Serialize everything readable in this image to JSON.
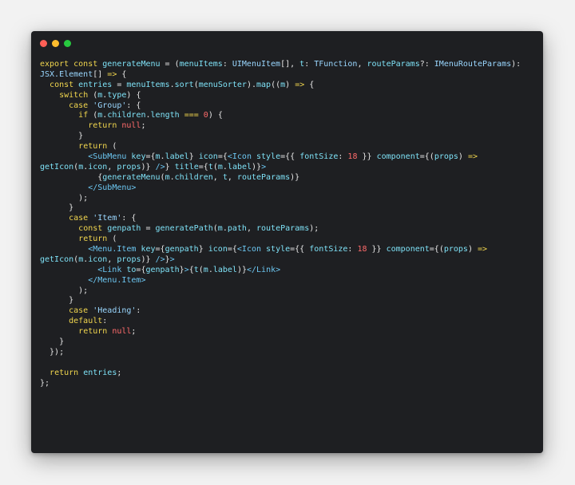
{
  "window": {
    "dots": [
      {
        "name": "close",
        "color": "#ff5f56"
      },
      {
        "name": "minimize",
        "color": "#ffbd2e"
      },
      {
        "name": "maximize",
        "color": "#27c93f"
      }
    ]
  },
  "code": {
    "lines": [
      [
        [
          "kw",
          "export const "
        ],
        [
          "fn",
          "generateMenu"
        ],
        [
          "pun",
          " = ("
        ],
        [
          "att",
          "menuItems"
        ],
        [
          "pun",
          ": "
        ],
        [
          "ty",
          "UIMenuItem"
        ],
        [
          "pun",
          "[], "
        ],
        [
          "att",
          "t"
        ],
        [
          "pun",
          ": "
        ],
        [
          "ty",
          "TFunction"
        ],
        [
          "pun",
          ", "
        ],
        [
          "att",
          "routeParams"
        ],
        [
          "pun",
          "?: "
        ],
        [
          "ty",
          "IMenuRouteParams"
        ],
        [
          "pun",
          "):"
        ]
      ],
      [
        [
          "ty",
          "JSX.Element"
        ],
        [
          "pun",
          "[] "
        ],
        [
          "kw",
          "=>"
        ],
        [
          "pun",
          " {"
        ]
      ],
      [
        [
          "pun",
          "  "
        ],
        [
          "kw",
          "const "
        ],
        [
          "att",
          "entries"
        ],
        [
          "pun",
          " = "
        ],
        [
          "att",
          "menuItems"
        ],
        [
          "pun",
          "."
        ],
        [
          "fn",
          "sort"
        ],
        [
          "pun",
          "("
        ],
        [
          "att",
          "menuSorter"
        ],
        [
          "pun",
          ")."
        ],
        [
          "fn",
          "map"
        ],
        [
          "pun",
          "(("
        ],
        [
          "att",
          "m"
        ],
        [
          "pun",
          ") "
        ],
        [
          "kw",
          "=>"
        ],
        [
          "pun",
          " {"
        ]
      ],
      [
        [
          "pun",
          "    "
        ],
        [
          "kw",
          "switch"
        ],
        [
          "pun",
          " ("
        ],
        [
          "att",
          "m"
        ],
        [
          "pun",
          "."
        ],
        [
          "att",
          "type"
        ],
        [
          "pun",
          ") {"
        ]
      ],
      [
        [
          "pun",
          "      "
        ],
        [
          "kw",
          "case "
        ],
        [
          "str",
          "'Group'"
        ],
        [
          "pun",
          ": {"
        ]
      ],
      [
        [
          "pun",
          "        "
        ],
        [
          "kw",
          "if"
        ],
        [
          "pun",
          " ("
        ],
        [
          "att",
          "m"
        ],
        [
          "pun",
          "."
        ],
        [
          "att",
          "children"
        ],
        [
          "pun",
          "."
        ],
        [
          "att",
          "length"
        ],
        [
          "pun",
          " "
        ],
        [
          "kw",
          "==="
        ],
        [
          "pun",
          " "
        ],
        [
          "num",
          "0"
        ],
        [
          "pun",
          ") {"
        ]
      ],
      [
        [
          "pun",
          "          "
        ],
        [
          "kw",
          "return "
        ],
        [
          "nul",
          "null"
        ],
        [
          "pun",
          ";"
        ]
      ],
      [
        [
          "pun",
          "        }"
        ]
      ],
      [
        [
          "pun",
          "        "
        ],
        [
          "kw",
          "return"
        ],
        [
          "pun",
          " ("
        ]
      ],
      [
        [
          "pun",
          "          "
        ],
        [
          "tag",
          "<SubMenu "
        ],
        [
          "att",
          "key"
        ],
        [
          "pun",
          "={"
        ],
        [
          "att",
          "m"
        ],
        [
          "pun",
          "."
        ],
        [
          "att",
          "label"
        ],
        [
          "pun",
          "} "
        ],
        [
          "att",
          "icon"
        ],
        [
          "pun",
          "={"
        ],
        [
          "tag",
          "<Icon "
        ],
        [
          "att",
          "style"
        ],
        [
          "pun",
          "={{ "
        ],
        [
          "att",
          "fontSize"
        ],
        [
          "pun",
          ": "
        ],
        [
          "num",
          "18"
        ],
        [
          "pun",
          " }} "
        ],
        [
          "att",
          "component"
        ],
        [
          "pun",
          "={("
        ],
        [
          "att",
          "props"
        ],
        [
          "pun",
          ") "
        ],
        [
          "kw",
          "=>"
        ]
      ],
      [
        [
          "fn",
          "getIcon"
        ],
        [
          "pun",
          "("
        ],
        [
          "att",
          "m"
        ],
        [
          "pun",
          "."
        ],
        [
          "att",
          "icon"
        ],
        [
          "pun",
          ", "
        ],
        [
          "att",
          "props"
        ],
        [
          "pun",
          ")} "
        ],
        [
          "tag",
          "/>"
        ],
        [
          "pun",
          "} "
        ],
        [
          "att",
          "title"
        ],
        [
          "pun",
          "={"
        ],
        [
          "fn",
          "t"
        ],
        [
          "pun",
          "("
        ],
        [
          "att",
          "m"
        ],
        [
          "pun",
          "."
        ],
        [
          "att",
          "label"
        ],
        [
          "pun",
          ")}"
        ],
        [
          "tag",
          ">"
        ]
      ],
      [
        [
          "pun",
          "            {"
        ],
        [
          "fn",
          "generateMenu"
        ],
        [
          "pun",
          "("
        ],
        [
          "att",
          "m"
        ],
        [
          "pun",
          "."
        ],
        [
          "att",
          "children"
        ],
        [
          "pun",
          ", "
        ],
        [
          "att",
          "t"
        ],
        [
          "pun",
          ", "
        ],
        [
          "att",
          "routeParams"
        ],
        [
          "pun",
          ")}"
        ]
      ],
      [
        [
          "pun",
          "          "
        ],
        [
          "tag",
          "</SubMenu>"
        ]
      ],
      [
        [
          "pun",
          "        );"
        ]
      ],
      [
        [
          "pun",
          "      }"
        ]
      ],
      [
        [
          "pun",
          "      "
        ],
        [
          "kw",
          "case "
        ],
        [
          "str",
          "'Item'"
        ],
        [
          "pun",
          ": {"
        ]
      ],
      [
        [
          "pun",
          "        "
        ],
        [
          "kw",
          "const "
        ],
        [
          "att",
          "genpath"
        ],
        [
          "pun",
          " = "
        ],
        [
          "fn",
          "generatePath"
        ],
        [
          "pun",
          "("
        ],
        [
          "att",
          "m"
        ],
        [
          "pun",
          "."
        ],
        [
          "att",
          "path"
        ],
        [
          "pun",
          ", "
        ],
        [
          "att",
          "routeParams"
        ],
        [
          "pun",
          ");"
        ]
      ],
      [
        [
          "pun",
          "        "
        ],
        [
          "kw",
          "return"
        ],
        [
          "pun",
          " ("
        ]
      ],
      [
        [
          "pun",
          "          "
        ],
        [
          "tag",
          "<Menu.Item "
        ],
        [
          "att",
          "key"
        ],
        [
          "pun",
          "={"
        ],
        [
          "att",
          "genpath"
        ],
        [
          "pun",
          "} "
        ],
        [
          "att",
          "icon"
        ],
        [
          "pun",
          "={"
        ],
        [
          "tag",
          "<Icon "
        ],
        [
          "att",
          "style"
        ],
        [
          "pun",
          "={{ "
        ],
        [
          "att",
          "fontSize"
        ],
        [
          "pun",
          ": "
        ],
        [
          "num",
          "18"
        ],
        [
          "pun",
          " }} "
        ],
        [
          "att",
          "component"
        ],
        [
          "pun",
          "={("
        ],
        [
          "att",
          "props"
        ],
        [
          "pun",
          ") "
        ],
        [
          "kw",
          "=>"
        ]
      ],
      [
        [
          "fn",
          "getIcon"
        ],
        [
          "pun",
          "("
        ],
        [
          "att",
          "m"
        ],
        [
          "pun",
          "."
        ],
        [
          "att",
          "icon"
        ],
        [
          "pun",
          ", "
        ],
        [
          "att",
          "props"
        ],
        [
          "pun",
          ")} "
        ],
        [
          "tag",
          "/>"
        ],
        [
          "pun",
          "}"
        ],
        [
          "tag",
          ">"
        ]
      ],
      [
        [
          "pun",
          "            "
        ],
        [
          "tag",
          "<Link "
        ],
        [
          "att",
          "to"
        ],
        [
          "pun",
          "={"
        ],
        [
          "att",
          "genpath"
        ],
        [
          "pun",
          "}"
        ],
        [
          "tag",
          ">"
        ],
        [
          "pun",
          "{"
        ],
        [
          "fn",
          "t"
        ],
        [
          "pun",
          "("
        ],
        [
          "att",
          "m"
        ],
        [
          "pun",
          "."
        ],
        [
          "att",
          "label"
        ],
        [
          "pun",
          ")}"
        ],
        [
          "tag",
          "</Link>"
        ]
      ],
      [
        [
          "pun",
          "          "
        ],
        [
          "tag",
          "</Menu.Item>"
        ]
      ],
      [
        [
          "pun",
          "        );"
        ]
      ],
      [
        [
          "pun",
          "      }"
        ]
      ],
      [
        [
          "pun",
          "      "
        ],
        [
          "kw",
          "case "
        ],
        [
          "str",
          "'Heading'"
        ],
        [
          "pun",
          ":"
        ]
      ],
      [
        [
          "pun",
          "      "
        ],
        [
          "kw",
          "default"
        ],
        [
          "pun",
          ":"
        ]
      ],
      [
        [
          "pun",
          "        "
        ],
        [
          "kw",
          "return "
        ],
        [
          "nul",
          "null"
        ],
        [
          "pun",
          ";"
        ]
      ],
      [
        [
          "pun",
          "    }"
        ]
      ],
      [
        [
          "pun",
          "  });"
        ]
      ],
      [
        [
          "pun",
          ""
        ]
      ],
      [
        [
          "pun",
          "  "
        ],
        [
          "kw",
          "return "
        ],
        [
          "att",
          "entries"
        ],
        [
          "pun",
          ";"
        ]
      ],
      [
        [
          "pun",
          "};"
        ]
      ]
    ]
  }
}
